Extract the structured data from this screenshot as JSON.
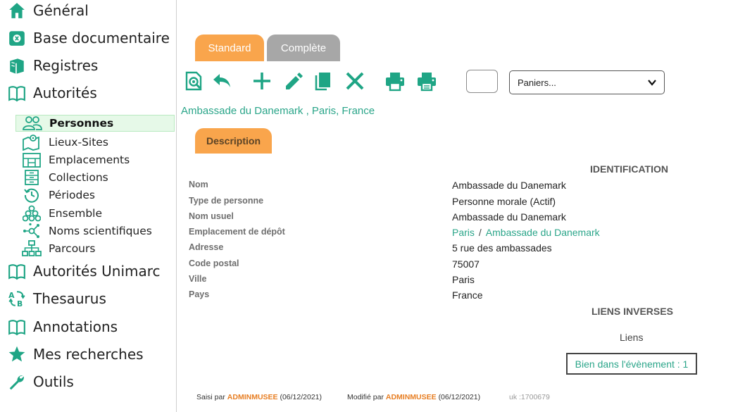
{
  "sidebar": {
    "main_items": [
      {
        "label": "Général",
        "icon": "home-icon"
      },
      {
        "label": "Base documentaire",
        "icon": "database-icon"
      },
      {
        "label": "Registres",
        "icon": "registers-icon"
      },
      {
        "label": "Autorités",
        "icon": "book-icon"
      },
      {
        "label": "Autorités Unimarc",
        "icon": "book-icon"
      },
      {
        "label": "Thesaurus",
        "icon": "thesaurus-icon"
      },
      {
        "label": "Annotations",
        "icon": "book-icon"
      },
      {
        "label": "Mes recherches",
        "icon": "star-icon"
      },
      {
        "label": "Outils",
        "icon": "wrench-icon"
      }
    ],
    "sub_items": [
      {
        "label": "Personnes",
        "icon": "people-icon",
        "active": true
      },
      {
        "label": "Lieux-Sites",
        "icon": "map-icon"
      },
      {
        "label": "Emplacements",
        "icon": "building-icon"
      },
      {
        "label": "Collections",
        "icon": "cabinet-icon"
      },
      {
        "label": "Périodes",
        "icon": "history-icon"
      },
      {
        "label": "Ensemble",
        "icon": "cluster-icon"
      },
      {
        "label": "Noms scientifiques",
        "icon": "network-icon"
      },
      {
        "label": "Parcours",
        "icon": "tree-icon"
      }
    ]
  },
  "tabs": {
    "standard": "Standard",
    "complete": "Complète",
    "description": "Description"
  },
  "toolbar": {
    "paniers": "Paniers..."
  },
  "record": {
    "title": "Ambassade du Danemark , Paris, France",
    "section_identification": "IDENTIFICATION",
    "fields": [
      {
        "label": "Nom",
        "value": "Ambassade du Danemark"
      },
      {
        "label": "Type de personne",
        "value": "Personne morale (Actif)"
      },
      {
        "label": "Nom usuel",
        "value": "Ambassade du Danemark"
      },
      {
        "label": "Emplacement de dépôt",
        "link1": "Paris",
        "separator": "/",
        "link2": "Ambassade du Danemark"
      },
      {
        "label": "Adresse",
        "value": "5 rue des ambassades"
      },
      {
        "label": "Code postal",
        "value": "75007"
      },
      {
        "label": "Ville",
        "value": "Paris"
      },
      {
        "label": "Pays",
        "value": "France"
      }
    ],
    "section_liens": "LIENS INVERSES",
    "liens_sub": "Liens",
    "liens_link": "Bien dans l'évènement : 1"
  },
  "footer": {
    "saisi_prefix": "Saisi par",
    "saisi_user": "ADMINMUSEE",
    "saisi_date": "(06/12/2021)",
    "modifie_prefix": "Modifié par",
    "modifie_user": "ADMINMUSEE",
    "modifie_date": "(06/12/2021)",
    "uk": "uk :1700679"
  },
  "colors": {
    "accent": "#1fa585",
    "tab_orange": "#f9a54c",
    "tab_grey": "#a7a7a7",
    "link": "#2aa589",
    "footer_user": "#e77e22"
  }
}
